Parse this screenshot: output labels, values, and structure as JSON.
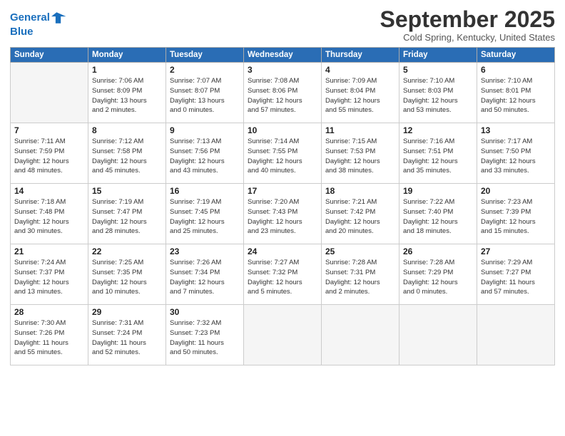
{
  "logo": {
    "line1": "General",
    "line2": "Blue"
  },
  "title": "September 2025",
  "location": "Cold Spring, Kentucky, United States",
  "headers": [
    "Sunday",
    "Monday",
    "Tuesday",
    "Wednesday",
    "Thursday",
    "Friday",
    "Saturday"
  ],
  "weeks": [
    [
      {
        "day": "",
        "info": ""
      },
      {
        "day": "1",
        "info": "Sunrise: 7:06 AM\nSunset: 8:09 PM\nDaylight: 13 hours\nand 2 minutes."
      },
      {
        "day": "2",
        "info": "Sunrise: 7:07 AM\nSunset: 8:07 PM\nDaylight: 13 hours\nand 0 minutes."
      },
      {
        "day": "3",
        "info": "Sunrise: 7:08 AM\nSunset: 8:06 PM\nDaylight: 12 hours\nand 57 minutes."
      },
      {
        "day": "4",
        "info": "Sunrise: 7:09 AM\nSunset: 8:04 PM\nDaylight: 12 hours\nand 55 minutes."
      },
      {
        "day": "5",
        "info": "Sunrise: 7:10 AM\nSunset: 8:03 PM\nDaylight: 12 hours\nand 53 minutes."
      },
      {
        "day": "6",
        "info": "Sunrise: 7:10 AM\nSunset: 8:01 PM\nDaylight: 12 hours\nand 50 minutes."
      }
    ],
    [
      {
        "day": "7",
        "info": "Sunrise: 7:11 AM\nSunset: 7:59 PM\nDaylight: 12 hours\nand 48 minutes."
      },
      {
        "day": "8",
        "info": "Sunrise: 7:12 AM\nSunset: 7:58 PM\nDaylight: 12 hours\nand 45 minutes."
      },
      {
        "day": "9",
        "info": "Sunrise: 7:13 AM\nSunset: 7:56 PM\nDaylight: 12 hours\nand 43 minutes."
      },
      {
        "day": "10",
        "info": "Sunrise: 7:14 AM\nSunset: 7:55 PM\nDaylight: 12 hours\nand 40 minutes."
      },
      {
        "day": "11",
        "info": "Sunrise: 7:15 AM\nSunset: 7:53 PM\nDaylight: 12 hours\nand 38 minutes."
      },
      {
        "day": "12",
        "info": "Sunrise: 7:16 AM\nSunset: 7:51 PM\nDaylight: 12 hours\nand 35 minutes."
      },
      {
        "day": "13",
        "info": "Sunrise: 7:17 AM\nSunset: 7:50 PM\nDaylight: 12 hours\nand 33 minutes."
      }
    ],
    [
      {
        "day": "14",
        "info": "Sunrise: 7:18 AM\nSunset: 7:48 PM\nDaylight: 12 hours\nand 30 minutes."
      },
      {
        "day": "15",
        "info": "Sunrise: 7:19 AM\nSunset: 7:47 PM\nDaylight: 12 hours\nand 28 minutes."
      },
      {
        "day": "16",
        "info": "Sunrise: 7:19 AM\nSunset: 7:45 PM\nDaylight: 12 hours\nand 25 minutes."
      },
      {
        "day": "17",
        "info": "Sunrise: 7:20 AM\nSunset: 7:43 PM\nDaylight: 12 hours\nand 23 minutes."
      },
      {
        "day": "18",
        "info": "Sunrise: 7:21 AM\nSunset: 7:42 PM\nDaylight: 12 hours\nand 20 minutes."
      },
      {
        "day": "19",
        "info": "Sunrise: 7:22 AM\nSunset: 7:40 PM\nDaylight: 12 hours\nand 18 minutes."
      },
      {
        "day": "20",
        "info": "Sunrise: 7:23 AM\nSunset: 7:39 PM\nDaylight: 12 hours\nand 15 minutes."
      }
    ],
    [
      {
        "day": "21",
        "info": "Sunrise: 7:24 AM\nSunset: 7:37 PM\nDaylight: 12 hours\nand 13 minutes."
      },
      {
        "day": "22",
        "info": "Sunrise: 7:25 AM\nSunset: 7:35 PM\nDaylight: 12 hours\nand 10 minutes."
      },
      {
        "day": "23",
        "info": "Sunrise: 7:26 AM\nSunset: 7:34 PM\nDaylight: 12 hours\nand 7 minutes."
      },
      {
        "day": "24",
        "info": "Sunrise: 7:27 AM\nSunset: 7:32 PM\nDaylight: 12 hours\nand 5 minutes."
      },
      {
        "day": "25",
        "info": "Sunrise: 7:28 AM\nSunset: 7:31 PM\nDaylight: 12 hours\nand 2 minutes."
      },
      {
        "day": "26",
        "info": "Sunrise: 7:28 AM\nSunset: 7:29 PM\nDaylight: 12 hours\nand 0 minutes."
      },
      {
        "day": "27",
        "info": "Sunrise: 7:29 AM\nSunset: 7:27 PM\nDaylight: 11 hours\nand 57 minutes."
      }
    ],
    [
      {
        "day": "28",
        "info": "Sunrise: 7:30 AM\nSunset: 7:26 PM\nDaylight: 11 hours\nand 55 minutes."
      },
      {
        "day": "29",
        "info": "Sunrise: 7:31 AM\nSunset: 7:24 PM\nDaylight: 11 hours\nand 52 minutes."
      },
      {
        "day": "30",
        "info": "Sunrise: 7:32 AM\nSunset: 7:23 PM\nDaylight: 11 hours\nand 50 minutes."
      },
      {
        "day": "",
        "info": ""
      },
      {
        "day": "",
        "info": ""
      },
      {
        "day": "",
        "info": ""
      },
      {
        "day": "",
        "info": ""
      }
    ]
  ]
}
